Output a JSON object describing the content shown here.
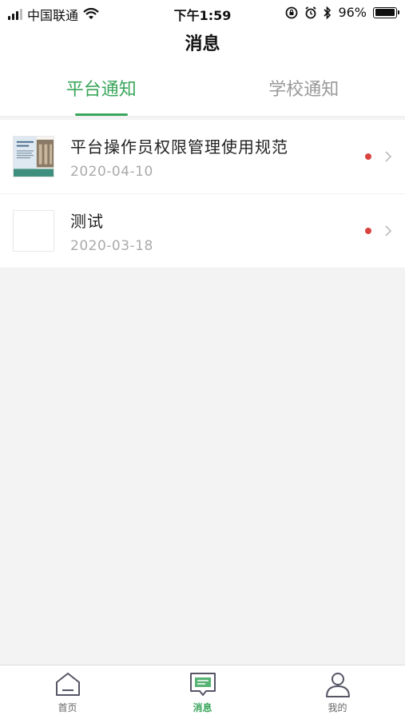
{
  "status": {
    "carrier": "中国联通",
    "time": "下午1:59",
    "battery_text": "96%",
    "battery_level": 0.96
  },
  "nav": {
    "title": "消息"
  },
  "tabs": [
    {
      "label": "平台通知",
      "active": true
    },
    {
      "label": "学校通知",
      "active": false
    }
  ],
  "messages": [
    {
      "title": "平台操作员权限管理使用规范",
      "date": "2020-04-10",
      "unread": true,
      "has_thumbnail": true
    },
    {
      "title": "测试",
      "date": "2020-03-18",
      "unread": true,
      "has_thumbnail": false
    }
  ],
  "tabbar": [
    {
      "label": "首页",
      "icon": "home-icon",
      "active": false
    },
    {
      "label": "消息",
      "icon": "message-icon",
      "active": true
    },
    {
      "label": "我的",
      "icon": "user-icon",
      "active": false
    }
  ],
  "colors": {
    "accent": "#3aa65b",
    "unread_dot": "#d9443f",
    "background": "#f3f3f3"
  }
}
